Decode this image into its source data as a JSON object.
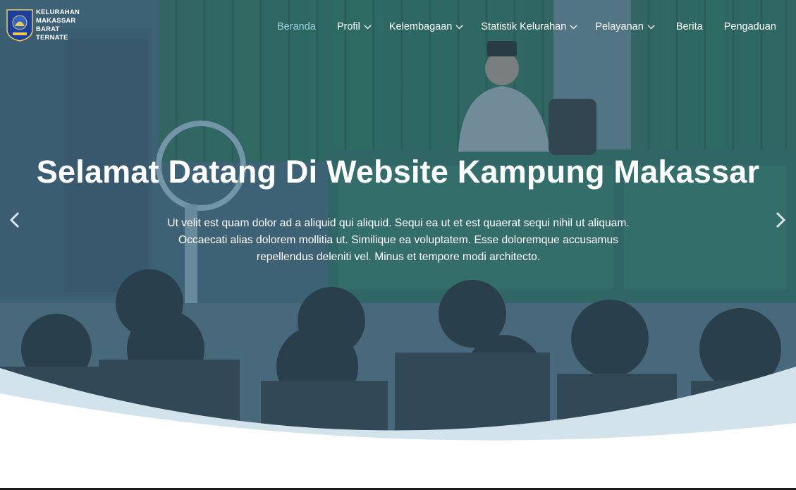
{
  "site": {
    "logo_lines": [
      "KELURAHAN",
      "MAKASSAR",
      "BARAT",
      "TERNATE"
    ]
  },
  "nav": {
    "items": [
      {
        "label": "Beranda",
        "active": true,
        "dropdown": false
      },
      {
        "label": "Profil",
        "active": false,
        "dropdown": true
      },
      {
        "label": "Kelembagaan",
        "active": false,
        "dropdown": true
      },
      {
        "label": "Statistik Kelurahan",
        "active": false,
        "dropdown": true
      },
      {
        "label": "Pelayanan",
        "active": false,
        "dropdown": true
      },
      {
        "label": "Berita",
        "active": false,
        "dropdown": false
      },
      {
        "label": "Pengaduan",
        "active": false,
        "dropdown": false
      }
    ]
  },
  "hero": {
    "title": "Selamat Datang Di Website Kampung Makassar",
    "description": "Ut velit est quam dolor ad a aliquid qui aliquid. Sequi ea ut et est quaerat sequi nihil ut aliquam. Occaecati alias dolorem mollitia ut. Similique ea voluptatem. Esse doloremque accusamus repellendus deleniti vel. Minus et tempore modi architecto.",
    "prev_icon": "chevron-left-icon",
    "next_icon": "chevron-right-icon"
  },
  "colors": {
    "active_nav": "#9fd0e6",
    "overlay": "#3d5f73",
    "wave_light": "#d3e3ec",
    "page_bg": "#ffffff"
  }
}
